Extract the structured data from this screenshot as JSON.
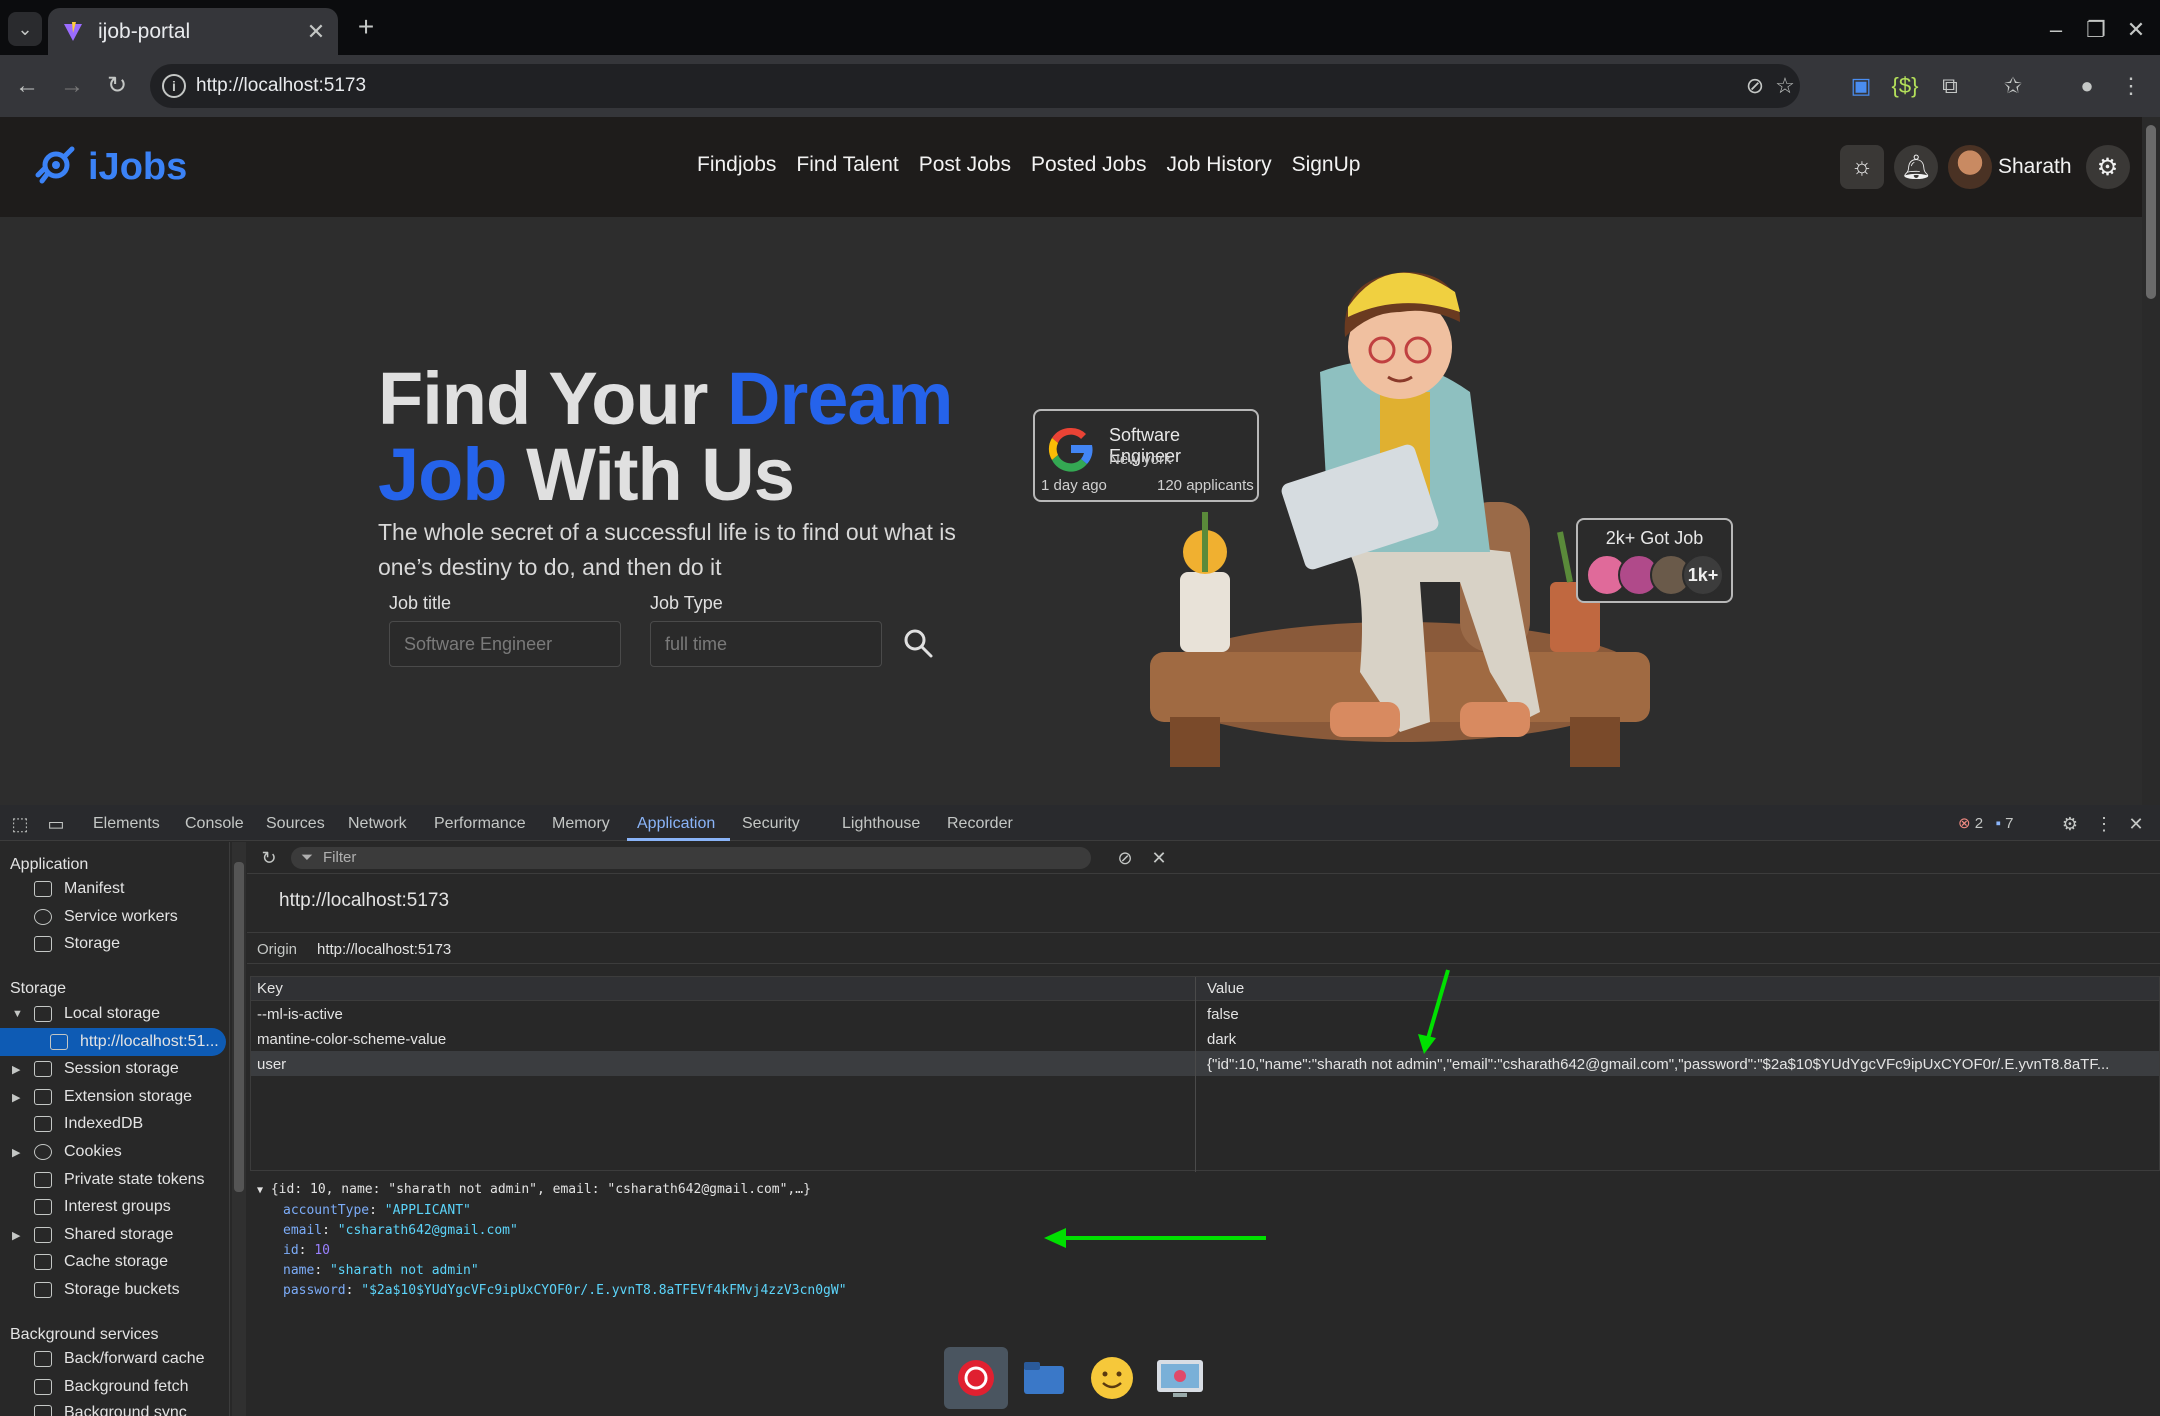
{
  "browser": {
    "tab_title": "ijob-portal",
    "url": "http://localhost:5173"
  },
  "site": {
    "logo_text": "iJobs",
    "nav": [
      "Findjobs",
      "Find Talent",
      "Post Jobs",
      "Posted Jobs",
      "Job History",
      "SignUp"
    ],
    "username": "Sharath",
    "hero": {
      "line1_a": "Find Your ",
      "line1_b": "Dream",
      "line2_a": "Job",
      "line2_b": " With Us",
      "subtitle": "The whole secret of a successful life is to find out what is one’s destiny to do, and then do it"
    },
    "search": {
      "job_title_label": "Job title",
      "job_title_placeholder": "Software Engineer",
      "job_type_label": "Job Type",
      "job_type_placeholder": "full time"
    },
    "job_card": {
      "title": "Software Engineer",
      "location": "New york",
      "posted": "1 day ago",
      "applicants": "120 applicants"
    },
    "got_job_card": {
      "title": "2k+ Got Job",
      "more": "1k+"
    }
  },
  "devtools": {
    "tabs": [
      "Elements",
      "Console",
      "Sources",
      "Network",
      "Performance",
      "Memory",
      "Application",
      "Security",
      "Lighthouse",
      "Recorder"
    ],
    "active_tab": "Application",
    "errors": "2",
    "messages": "7",
    "filter_placeholder": "Filter",
    "sidebar": {
      "application_title": "Application",
      "application_items": [
        "Manifest",
        "Service workers",
        "Storage"
      ],
      "storage_title": "Storage",
      "local_storage": "Local storage",
      "local_storage_child": "http://localhost:51...",
      "storage_items": [
        "Session storage",
        "Extension storage",
        "IndexedDB",
        "Cookies",
        "Private state tokens",
        "Interest groups",
        "Shared storage",
        "Cache storage",
        "Storage buckets"
      ],
      "background_title": "Background services",
      "background_items": [
        "Back/forward cache",
        "Background fetch",
        "Background sync"
      ]
    },
    "storage_view": {
      "title": "http://localhost:5173",
      "origin_label": "Origin",
      "origin_value": "http://localhost:5173",
      "key_header": "Key",
      "value_header": "Value",
      "rows": [
        {
          "key": "--ml-is-active",
          "value": "false"
        },
        {
          "key": "mantine-color-scheme-value",
          "value": "dark"
        },
        {
          "key": "user",
          "value": "{\"id\":10,\"name\":\"sharath not admin\",\"email\":\"csharath642@gmail.com\",\"password\":\"$2a$10$YUdYgcVFc9ipUxCYOF0r/.E.yvnT8.8aTF..."
        }
      ]
    },
    "preview": {
      "summary": "{id: 10, name: \"sharath not admin\", email: \"csharath642@gmail.com\",…}",
      "fields": [
        {
          "k": "accountType",
          "v": "\"APPLICANT\"",
          "type": "string"
        },
        {
          "k": "email",
          "v": "\"csharath642@gmail.com\"",
          "type": "string"
        },
        {
          "k": "id",
          "v": "10",
          "type": "number"
        },
        {
          "k": "name",
          "v": "\"sharath not admin\"",
          "type": "string"
        },
        {
          "k": "password",
          "v": "\"$2a$10$YUdYgcVFc9ipUxCYOF0r/.E.yvnT8.8aTFEVf4kFMvj4zzV3cn0gW\"",
          "type": "string"
        }
      ]
    }
  },
  "colors": {
    "accent_blue": "#2563eb",
    "devtools_active": "#8ab4f8",
    "annotation_arrow": "#00e000"
  }
}
